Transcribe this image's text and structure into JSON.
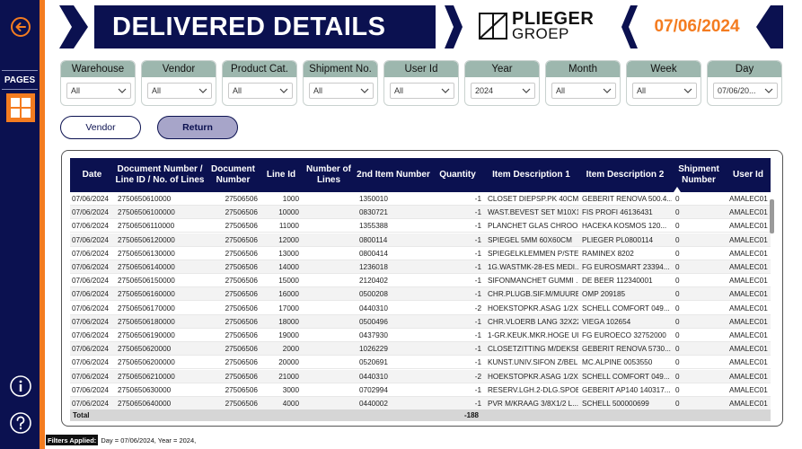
{
  "header": {
    "title": "DELIVERED DETAILS",
    "logo_line1": "PLIEGER",
    "logo_line2": "GROEP",
    "date": "07/06/2024",
    "accent": "#f47c20",
    "navy": "#0b1150"
  },
  "sidebar": {
    "pages_label": "PAGES",
    "back_icon": "back-arrow-icon",
    "grid_icon": "grid-icon",
    "info_icon": "info-icon",
    "help_icon": "help-icon"
  },
  "slicers": [
    {
      "label": "Warehouse",
      "value": "All"
    },
    {
      "label": "Vendor",
      "value": "All"
    },
    {
      "label": "Product Cat.",
      "value": "All"
    },
    {
      "label": "Shipment No.",
      "value": "All"
    },
    {
      "label": "User Id",
      "value": "All"
    },
    {
      "label": "Year",
      "value": "2024"
    },
    {
      "label": "Month",
      "value": "All"
    },
    {
      "label": "Week",
      "value": "All"
    },
    {
      "label": "Day",
      "value": "07/06/20..."
    }
  ],
  "buttons": {
    "vendor": "Vendor",
    "return": "Return"
  },
  "table": {
    "columns": [
      "Date",
      "Document Number / Line ID / No. of Lines",
      "Document Number",
      "Line Id",
      "Number of Lines",
      "2nd Item Number",
      "Quantity",
      "Item Description 1",
      "Item Description 2",
      "Shipment Number",
      "User Id"
    ],
    "rows": [
      [
        "07/06/2024",
        "2750650610000",
        "27506506",
        "1000",
        "",
        "1350010",
        "-1",
        "CLOSET DIEPSP.PK 40CM ...",
        "GEBERIT RENOVA 500.4...",
        "0",
        "AMALEC01"
      ],
      [
        "07/06/2024",
        "27506506100000",
        "27506506",
        "10000",
        "",
        "0830721",
        "-1",
        "WAST.BEVEST SET M10X1...",
        "FIS PROFI 46136431",
        "0",
        "AMALEC01"
      ],
      [
        "07/06/2024",
        "27506506110000",
        "27506506",
        "11000",
        "",
        "1355388",
        "-1",
        "PLANCHET GLAS CHROO...",
        "HACEKA KOSMOS 120...",
        "0",
        "AMALEC01"
      ],
      [
        "07/06/2024",
        "27506506120000",
        "27506506",
        "12000",
        "",
        "0800114",
        "-1",
        "SPIEGEL 5MM 60X60CM",
        "PLIEGER PL0800114",
        "0",
        "AMALEC01"
      ],
      [
        "07/06/2024",
        "27506506130000",
        "27506506",
        "13000",
        "",
        "0800414",
        "-1",
        "SPIEGELKLEMMEN P/STEL ...",
        "RAMINEX 8202",
        "0",
        "AMALEC01"
      ],
      [
        "07/06/2024",
        "27506506140000",
        "27506506",
        "14000",
        "",
        "1236018",
        "-1",
        "1G.WASTMK-28-ES MEDI...",
        "FG EUROSMART 23394...",
        "0",
        "AMALEC01"
      ],
      [
        "07/06/2024",
        "27506506150000",
        "27506506",
        "15000",
        "",
        "2120402",
        "-1",
        "SIFONMANCHET GUMMI ...",
        "DE BEER 112340001",
        "0",
        "AMALEC01"
      ],
      [
        "07/06/2024",
        "27506506160000",
        "27506506",
        "16000",
        "",
        "0500208",
        "-1",
        "CHR.PLUGB.SIF.M/MUURB...",
        "OMP 209185",
        "0",
        "AMALEC01"
      ],
      [
        "07/06/2024",
        "27506506170000",
        "27506506",
        "17000",
        "",
        "0440310",
        "-2",
        "HOEKSTOPKR.ASAG 1/2X1...",
        "SCHELL COMFORT 049...",
        "0",
        "AMALEC01"
      ],
      [
        "07/06/2024",
        "27506506180000",
        "27506506",
        "18000",
        "",
        "0500496",
        "-1",
        "CHR.VLOERB LANG 32X22...",
        "VIEGA 102654",
        "0",
        "AMALEC01"
      ],
      [
        "07/06/2024",
        "27506506190000",
        "27506506",
        "19000",
        "",
        "0437930",
        "-1",
        "1-GR.KEUK.MKR.HOGE UIT...",
        "FG EUROECO 32752000",
        "0",
        "AMALEC01"
      ],
      [
        "07/06/2024",
        "2750650620000",
        "27506506",
        "2000",
        "",
        "1026229",
        "-1",
        "CLOSETZITTING M/DEKSE...",
        "GEBERIT RENOVA 5730...",
        "0",
        "AMALEC01"
      ],
      [
        "07/06/2024",
        "27506506200000",
        "27506506",
        "20000",
        "",
        "0520691",
        "-1",
        "KUNST.UNIV.SIFON Z/BEL...",
        "MC.ALPINE 0053550",
        "0",
        "AMALEC01"
      ],
      [
        "07/06/2024",
        "27506506210000",
        "27506506",
        "21000",
        "",
        "0440310",
        "-2",
        "HOEKSTOPKR.ASAG 1/2X1...",
        "SCHELL COMFORT 049...",
        "0",
        "AMALEC01"
      ],
      [
        "07/06/2024",
        "2750650630000",
        "27506506",
        "3000",
        "",
        "0702994",
        "-1",
        "RESERV.LGH.2-DLG.SPOEL...",
        "GEBERIT AP140 140317...",
        "0",
        "AMALEC01"
      ],
      [
        "07/06/2024",
        "2750650640000",
        "27506506",
        "4000",
        "",
        "0440002",
        "-1",
        "PVR M/KRAAG 3/8X1/2 L...",
        "SCHELL 500000699",
        "0",
        "AMALEC01"
      ]
    ],
    "total_label": "Total",
    "total_quantity": "-188"
  },
  "footer": {
    "label": "Filters Applied:",
    "text": "Day = 07/06/2024, Year = 2024,"
  }
}
